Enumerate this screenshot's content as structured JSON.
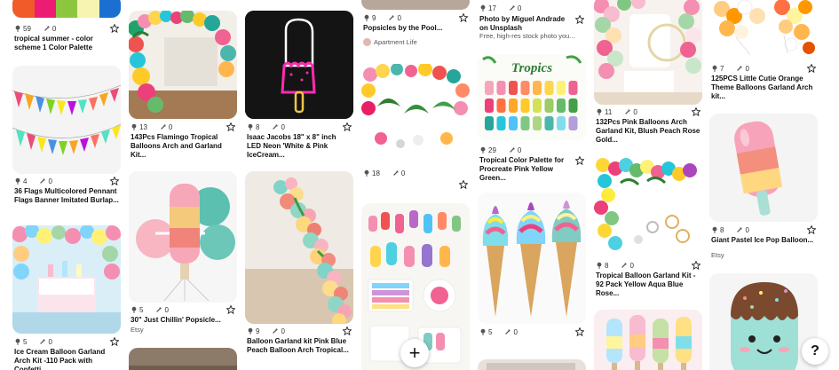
{
  "accent": "#e60023",
  "icons": {
    "save_count": "pushpin-icon",
    "repin_count": "heart-icon",
    "favorite": "star-icon",
    "add": "plus-icon",
    "help": "question-mark-icon"
  },
  "fab": {
    "add_label": "+"
  },
  "help": {
    "label": "?"
  },
  "pins": {
    "p1": {
      "saves": "59",
      "repins": "0",
      "title": "tropical summer - color scheme 1 Color Palette"
    },
    "p2": {
      "saves": "4",
      "repins": "0",
      "title": "36 Flags Multicolored Pennant Flags Banner Imitated Burlap..."
    },
    "p3": {
      "saves": "5",
      "repins": "0",
      "title": "Ice Cream Balloon Garland Arch Kit -110 Pack with Confetti..."
    },
    "p4": {
      "saves": "13",
      "repins": "0",
      "title": "143Pcs Flamingo Tropical Balloons Arch and Garland Kit..."
    },
    "p5": {
      "saves": "5",
      "repins": "0",
      "title": "30\" Just Chillin' Popsicle...",
      "source": "Etsy"
    },
    "p6": {
      "saves": "8",
      "repins": "0",
      "title": "Isaac Jacobs 18\" x 8\" inch LED Neon 'White & Pink IceCream..."
    },
    "p7": {
      "saves": "9",
      "repins": "0",
      "title": "Balloon Garland kit Pink Blue Peach Balloon Arch Tropical..."
    },
    "p8": {
      "saves": "9",
      "repins": "0",
      "title": "Popsicles by the Pool...",
      "source": "Apartment Life"
    },
    "p9": {
      "saves": "18",
      "repins": "0"
    },
    "p10": {
      "saves": "17",
      "repins": "0",
      "title": "Photo by Miguel Andrade on Unsplash",
      "subtitle": "Free, high-res stock photo you..."
    },
    "p11": {
      "saves": "29",
      "repins": "0",
      "title": "Tropical Color Palette for Procreate Pink Yellow Green...",
      "image_text": "Tropics"
    },
    "p12": {
      "saves": "5",
      "repins": "0"
    },
    "p13": {
      "saves": "11",
      "repins": "0",
      "title": "132Pcs Pink Balloons Arch Garland Kit, Blush Peach Rose Gold..."
    },
    "p14": {
      "saves": "8",
      "repins": "0",
      "title": "Tropical Balloon Garland Kit - 92 Pack Yellow Aqua Blue Rose..."
    },
    "p15": {
      "saves": "7",
      "repins": "0",
      "title": "125PCS Little Cutie Orange Theme Balloons Garland Arch kit..."
    },
    "p16": {
      "saves": "8",
      "repins": "0",
      "title": "Giant Pastel Ice Pop Balloon...",
      "source": "Etsy"
    }
  }
}
